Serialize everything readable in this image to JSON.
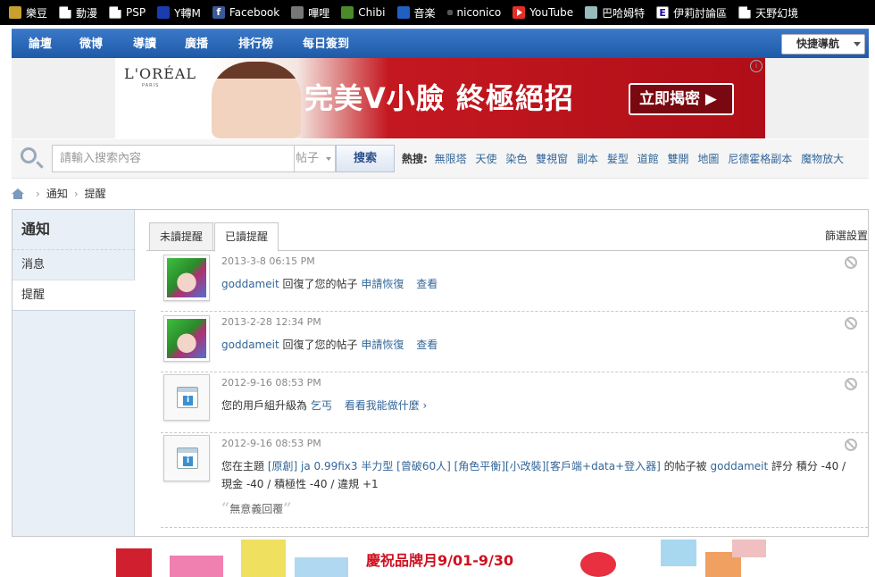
{
  "bookmarks": [
    {
      "label": "樂豆",
      "icon": "leaf-icon"
    },
    {
      "label": "動漫",
      "icon": "document-icon"
    },
    {
      "label": "PSP",
      "icon": "document-icon"
    },
    {
      "label": "Y轉M",
      "icon": "ymp-icon"
    },
    {
      "label": "Facebook",
      "icon": "facebook-icon"
    },
    {
      "label": "嗶哩",
      "icon": "tv-icon"
    },
    {
      "label": "Chibi",
      "icon": "chibi-icon"
    },
    {
      "label": "音楽",
      "icon": "music-note-icon"
    },
    {
      "label": "niconico",
      "icon": "dot-icon"
    },
    {
      "label": "YouTube",
      "icon": "youtube-icon"
    },
    {
      "label": "巴哈姆特",
      "icon": "bahamut-icon"
    },
    {
      "label": "伊莉討論區",
      "icon": "eyny-icon"
    },
    {
      "label": "天野幻境",
      "icon": "document-icon"
    }
  ],
  "nav": {
    "items": [
      "論壇",
      "微博",
      "導讀",
      "廣播",
      "排行榜",
      "每日簽到"
    ],
    "quick_nav": "快捷導航"
  },
  "banner": {
    "brand": "L'ORÉAL",
    "brand_sub": "PARIS",
    "slogan": "完美V小臉 終極絕招",
    "cta": "立即揭密 ▶",
    "info": "i"
  },
  "search": {
    "placeholder": "請輸入搜索內容",
    "type": "帖子",
    "button": "搜索",
    "hot_label": "熱搜:",
    "hot_keywords": [
      "無限塔",
      "天使",
      "染色",
      "雙視窗",
      "副本",
      "髮型",
      "道館",
      "雙開",
      "地圖",
      "尼德霍格副本",
      "魔物放大"
    ]
  },
  "breadcrumb": [
    "通知",
    "提醒"
  ],
  "sidebar": {
    "title": "通知",
    "items": [
      "消息",
      "提醒"
    ]
  },
  "tabs": {
    "unread": "未讀提醒",
    "read": "已讀提醒",
    "filter": "篩選設置"
  },
  "notices": [
    {
      "time": "2013-3-8 06:15 PM",
      "user": "goddameit",
      "text": "回復了您的帖子",
      "link1": "申請恢復",
      "link2": "查看"
    },
    {
      "time": "2013-2-28 12:34 PM",
      "user": "goddameit",
      "text": "回復了您的帖子",
      "link1": "申請恢復",
      "link2": "查看"
    },
    {
      "time": "2012-9-16 08:53 PM",
      "prefix": "您的用戶組升級為",
      "group": "乞丐",
      "more": "看看我能做什麼 ›"
    },
    {
      "time": "2012-9-16 08:53 PM",
      "prefix": "您在主題",
      "thread": "[原創] ja 0.99fix3 半力型 [曾破60人] [角色平衡][小改裝][客戶端+data+登入器]",
      "mid": "的帖子被",
      "user": "goddameit",
      "rating": "評分 積分 -40 / 現金 -40 / 積極性 -40 / 違規 +1",
      "quote": "無意義回覆"
    }
  ],
  "bottom_ad": {
    "text": "慶祝品牌月9/01-9/30"
  },
  "colors": {
    "nav_blue": "#1e5aa8",
    "link": "#336699",
    "sidebar_bg": "#e8eff7",
    "banner_red": "#c41820"
  }
}
